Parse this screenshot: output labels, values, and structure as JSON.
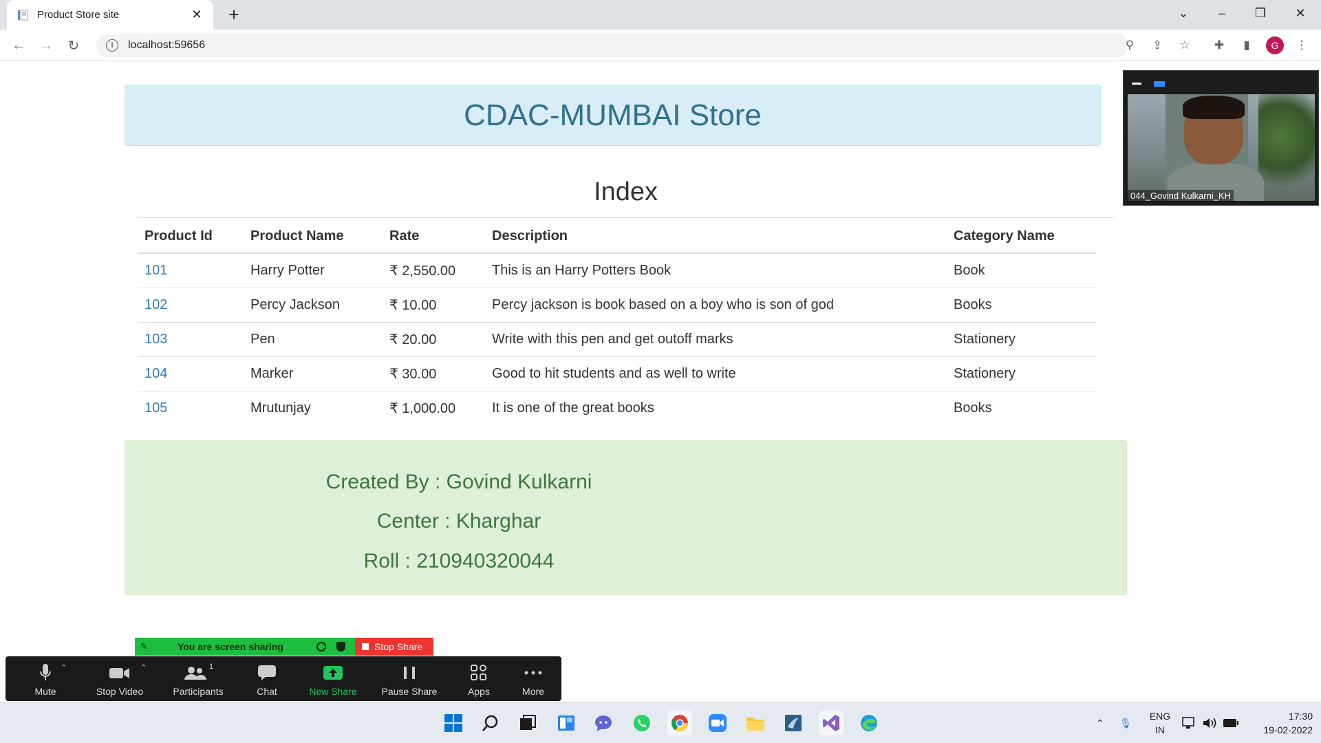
{
  "browser": {
    "tab_title": "Product Store site",
    "url": "localhost:59656",
    "profile_initial": "G"
  },
  "page": {
    "store_title": "CDAC-MUMBAI Store",
    "section_title": "Index",
    "table": {
      "headers": [
        "Product Id",
        "Product Name",
        "Rate",
        "Description",
        "Category Name"
      ],
      "rows": [
        {
          "id": "101",
          "name": "Harry Potter",
          "rate": "₹ 2,550.00",
          "description": "This is an Harry Potters Book",
          "category": "Book"
        },
        {
          "id": "102",
          "name": "Percy Jackson",
          "rate": "₹ 10.00",
          "description": "Percy jackson is book based on a boy who is son of god",
          "category": "Books"
        },
        {
          "id": "103",
          "name": "Pen",
          "rate": "₹ 20.00",
          "description": "Write with this pen and get outoff marks",
          "category": "Stationery"
        },
        {
          "id": "104",
          "name": "Marker",
          "rate": "₹ 30.00",
          "description": "Good to hit students and as well to write",
          "category": "Stationery"
        },
        {
          "id": "105",
          "name": "Mrutunjay",
          "rate": "₹ 1,000.00",
          "description": "It is one of the great books",
          "category": "Books"
        }
      ]
    },
    "footer": {
      "created_by": "Created By : Govind Kulkarni",
      "center": "Center : Kharghar",
      "roll": "Roll : 210940320044"
    }
  },
  "zoom": {
    "video_name": "044_Govind Kulkarni_KH",
    "sharing_text": "You are screen sharing",
    "stop_share": "Stop Share",
    "buttons": {
      "mute": "Mute",
      "stop_video": "Stop Video",
      "participants": "Participants",
      "participants_count": "1",
      "chat": "Chat",
      "new_share": "New Share",
      "pause_share": "Pause Share",
      "apps": "Apps",
      "more": "More"
    }
  },
  "taskbar": {
    "lang_line1": "ENG",
    "lang_line2": "IN",
    "time": "17:30",
    "date": "19-02-2022"
  },
  "colors": {
    "jumbotron_bg": "#d9edf7",
    "jumbotron_text": "#31708f",
    "footer_bg": "#dff0d8",
    "footer_text": "#3c763d",
    "link": "#337ab7",
    "share_green": "#1dbe3f",
    "stop_red": "#f0332f"
  }
}
